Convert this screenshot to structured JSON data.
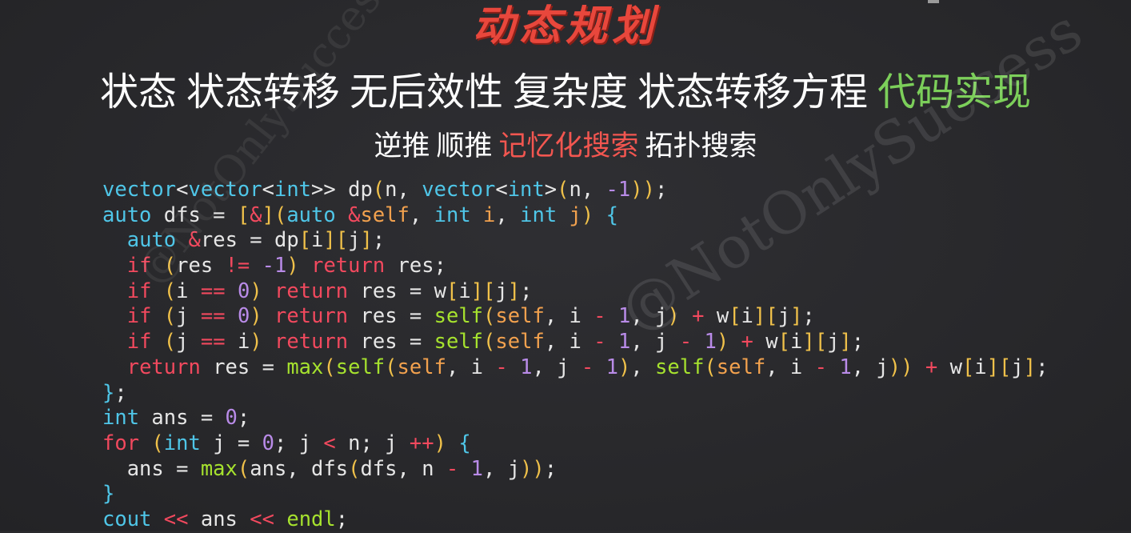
{
  "slide": {
    "title": "动态规划",
    "topics": [
      {
        "label": "状态",
        "active": false
      },
      {
        "label": "状态转移",
        "active": false
      },
      {
        "label": "无后效性",
        "active": false
      },
      {
        "label": "复杂度",
        "active": false
      },
      {
        "label": "状态转移方程",
        "active": false
      },
      {
        "label": "代码实现",
        "active": true
      }
    ],
    "methods": [
      {
        "label": "逆推",
        "active": false
      },
      {
        "label": "顺推",
        "active": false
      },
      {
        "label": "记忆化搜索",
        "active": true
      },
      {
        "label": "拓扑搜索",
        "active": false
      }
    ],
    "watermark": "@NotOnlySuccess"
  },
  "colors": {
    "title": "#e8473c",
    "topic_active": "#7ccf5a",
    "method_active": "#f25650",
    "type": "#4fc6e8",
    "keyword": "#f2495e",
    "number": "#b98be8",
    "function": "#a6e22e",
    "bracket": "#f0c14a",
    "param": "#f2a14e"
  },
  "code": [
    [
      [
        "type",
        "vector"
      ],
      [
        "plain",
        "<"
      ],
      [
        "type",
        "vector"
      ],
      [
        "plain",
        "<"
      ],
      [
        "type",
        "int"
      ],
      [
        "plain",
        ">> dp"
      ],
      [
        "punc",
        "("
      ],
      [
        "plain",
        "n, "
      ],
      [
        "type",
        "vector"
      ],
      [
        "plain",
        "<"
      ],
      [
        "type",
        "int"
      ],
      [
        "plain",
        ">"
      ],
      [
        "punc",
        "("
      ],
      [
        "plain",
        "n, "
      ],
      [
        "num",
        "-1"
      ],
      [
        "punc",
        "))"
      ],
      [
        "plain",
        ";"
      ]
    ],
    [
      [
        "type",
        "auto"
      ],
      [
        "plain",
        " dfs = "
      ],
      [
        "punc",
        "["
      ],
      [
        "op",
        "&"
      ],
      [
        "punc",
        "]("
      ],
      [
        "type",
        "auto"
      ],
      [
        "plain",
        " "
      ],
      [
        "op",
        "&"
      ],
      [
        "param",
        "self"
      ],
      [
        "plain",
        ", "
      ],
      [
        "type",
        "int"
      ],
      [
        "plain",
        " "
      ],
      [
        "param",
        "i"
      ],
      [
        "plain",
        ", "
      ],
      [
        "type",
        "int"
      ],
      [
        "plain",
        " "
      ],
      [
        "param",
        "j"
      ],
      [
        "punc",
        ")"
      ],
      [
        "plain",
        " "
      ],
      [
        "type",
        "{"
      ]
    ],
    [
      [
        "plain",
        "  "
      ],
      [
        "type",
        "auto"
      ],
      [
        "plain",
        " "
      ],
      [
        "op",
        "&"
      ],
      [
        "plain",
        "res = dp"
      ],
      [
        "punc",
        "["
      ],
      [
        "plain",
        "i"
      ],
      [
        "punc",
        "]["
      ],
      [
        "plain",
        "j"
      ],
      [
        "punc",
        "]"
      ],
      [
        "plain",
        ";"
      ]
    ],
    [
      [
        "plain",
        "  "
      ],
      [
        "kw",
        "if"
      ],
      [
        "plain",
        " "
      ],
      [
        "punc",
        "("
      ],
      [
        "plain",
        "res "
      ],
      [
        "op",
        "!="
      ],
      [
        "plain",
        " "
      ],
      [
        "num",
        "-1"
      ],
      [
        "punc",
        ")"
      ],
      [
        "plain",
        " "
      ],
      [
        "kw",
        "return"
      ],
      [
        "plain",
        " res;"
      ]
    ],
    [
      [
        "plain",
        "  "
      ],
      [
        "kw",
        "if"
      ],
      [
        "plain",
        " "
      ],
      [
        "punc",
        "("
      ],
      [
        "plain",
        "i "
      ],
      [
        "op",
        "=="
      ],
      [
        "plain",
        " "
      ],
      [
        "num",
        "0"
      ],
      [
        "punc",
        ")"
      ],
      [
        "plain",
        " "
      ],
      [
        "kw",
        "return"
      ],
      [
        "plain",
        " res = w"
      ],
      [
        "punc",
        "["
      ],
      [
        "plain",
        "i"
      ],
      [
        "punc",
        "]["
      ],
      [
        "plain",
        "j"
      ],
      [
        "punc",
        "]"
      ],
      [
        "plain",
        ";"
      ]
    ],
    [
      [
        "plain",
        "  "
      ],
      [
        "kw",
        "if"
      ],
      [
        "plain",
        " "
      ],
      [
        "punc",
        "("
      ],
      [
        "plain",
        "j "
      ],
      [
        "op",
        "=="
      ],
      [
        "plain",
        " "
      ],
      [
        "num",
        "0"
      ],
      [
        "punc",
        ")"
      ],
      [
        "plain",
        " "
      ],
      [
        "kw",
        "return"
      ],
      [
        "plain",
        " res = "
      ],
      [
        "fn",
        "self"
      ],
      [
        "punc",
        "("
      ],
      [
        "param",
        "self"
      ],
      [
        "plain",
        ", i "
      ],
      [
        "op",
        "-"
      ],
      [
        "plain",
        " "
      ],
      [
        "num",
        "1"
      ],
      [
        "plain",
        ", j"
      ],
      [
        "punc",
        ")"
      ],
      [
        "plain",
        " "
      ],
      [
        "op",
        "+"
      ],
      [
        "plain",
        " w"
      ],
      [
        "punc",
        "["
      ],
      [
        "plain",
        "i"
      ],
      [
        "punc",
        "]["
      ],
      [
        "plain",
        "j"
      ],
      [
        "punc",
        "]"
      ],
      [
        "plain",
        ";"
      ]
    ],
    [
      [
        "plain",
        "  "
      ],
      [
        "kw",
        "if"
      ],
      [
        "plain",
        " "
      ],
      [
        "punc",
        "("
      ],
      [
        "plain",
        "j "
      ],
      [
        "op",
        "=="
      ],
      [
        "plain",
        " i"
      ],
      [
        "punc",
        ")"
      ],
      [
        "plain",
        " "
      ],
      [
        "kw",
        "return"
      ],
      [
        "plain",
        " res = "
      ],
      [
        "fn",
        "self"
      ],
      [
        "punc",
        "("
      ],
      [
        "param",
        "self"
      ],
      [
        "plain",
        ", i "
      ],
      [
        "op",
        "-"
      ],
      [
        "plain",
        " "
      ],
      [
        "num",
        "1"
      ],
      [
        "plain",
        ", j "
      ],
      [
        "op",
        "-"
      ],
      [
        "plain",
        " "
      ],
      [
        "num",
        "1"
      ],
      [
        "punc",
        ")"
      ],
      [
        "plain",
        " "
      ],
      [
        "op",
        "+"
      ],
      [
        "plain",
        " w"
      ],
      [
        "punc",
        "["
      ],
      [
        "plain",
        "i"
      ],
      [
        "punc",
        "]["
      ],
      [
        "plain",
        "j"
      ],
      [
        "punc",
        "]"
      ],
      [
        "plain",
        ";"
      ]
    ],
    [
      [
        "plain",
        "  "
      ],
      [
        "kw",
        "return"
      ],
      [
        "plain",
        " res = "
      ],
      [
        "fn",
        "max"
      ],
      [
        "punc",
        "("
      ],
      [
        "fn",
        "self"
      ],
      [
        "punc",
        "("
      ],
      [
        "param",
        "self"
      ],
      [
        "plain",
        ", i "
      ],
      [
        "op",
        "-"
      ],
      [
        "plain",
        " "
      ],
      [
        "num",
        "1"
      ],
      [
        "plain",
        ", j "
      ],
      [
        "op",
        "-"
      ],
      [
        "plain",
        " "
      ],
      [
        "num",
        "1"
      ],
      [
        "punc",
        ")"
      ],
      [
        "plain",
        ", "
      ],
      [
        "fn",
        "self"
      ],
      [
        "punc",
        "("
      ],
      [
        "param",
        "self"
      ],
      [
        "plain",
        ", i "
      ],
      [
        "op",
        "-"
      ],
      [
        "plain",
        " "
      ],
      [
        "num",
        "1"
      ],
      [
        "plain",
        ", j"
      ],
      [
        "punc",
        "))"
      ],
      [
        "plain",
        " "
      ],
      [
        "op",
        "+"
      ],
      [
        "plain",
        " w"
      ],
      [
        "punc",
        "["
      ],
      [
        "plain",
        "i"
      ],
      [
        "punc",
        "]["
      ],
      [
        "plain",
        "j"
      ],
      [
        "punc",
        "]"
      ],
      [
        "plain",
        ";"
      ]
    ],
    [
      [
        "type",
        "}"
      ],
      [
        "plain",
        ";"
      ]
    ],
    [
      [
        "type",
        "int"
      ],
      [
        "plain",
        " ans = "
      ],
      [
        "num",
        "0"
      ],
      [
        "plain",
        ";"
      ]
    ],
    [
      [
        "kw",
        "for"
      ],
      [
        "plain",
        " "
      ],
      [
        "punc",
        "("
      ],
      [
        "type",
        "int"
      ],
      [
        "plain",
        " j = "
      ],
      [
        "num",
        "0"
      ],
      [
        "plain",
        "; j "
      ],
      [
        "op",
        "<"
      ],
      [
        "plain",
        " n; j "
      ],
      [
        "op",
        "++"
      ],
      [
        "punc",
        ")"
      ],
      [
        "plain",
        " "
      ],
      [
        "type",
        "{"
      ]
    ],
    [
      [
        "plain",
        "  ans = "
      ],
      [
        "fn",
        "max"
      ],
      [
        "punc",
        "("
      ],
      [
        "plain",
        "ans, dfs"
      ],
      [
        "punc",
        "("
      ],
      [
        "plain",
        "dfs, n "
      ],
      [
        "op",
        "-"
      ],
      [
        "plain",
        " "
      ],
      [
        "num",
        "1"
      ],
      [
        "plain",
        ", j"
      ],
      [
        "punc",
        "))"
      ],
      [
        "plain",
        ";"
      ]
    ],
    [
      [
        "type",
        "}"
      ]
    ],
    [
      [
        "type",
        "cout"
      ],
      [
        "plain",
        " "
      ],
      [
        "op",
        "<<"
      ],
      [
        "plain",
        " ans "
      ],
      [
        "op",
        "<<"
      ],
      [
        "plain",
        " "
      ],
      [
        "fn",
        "endl"
      ],
      [
        "plain",
        ";"
      ]
    ]
  ]
}
